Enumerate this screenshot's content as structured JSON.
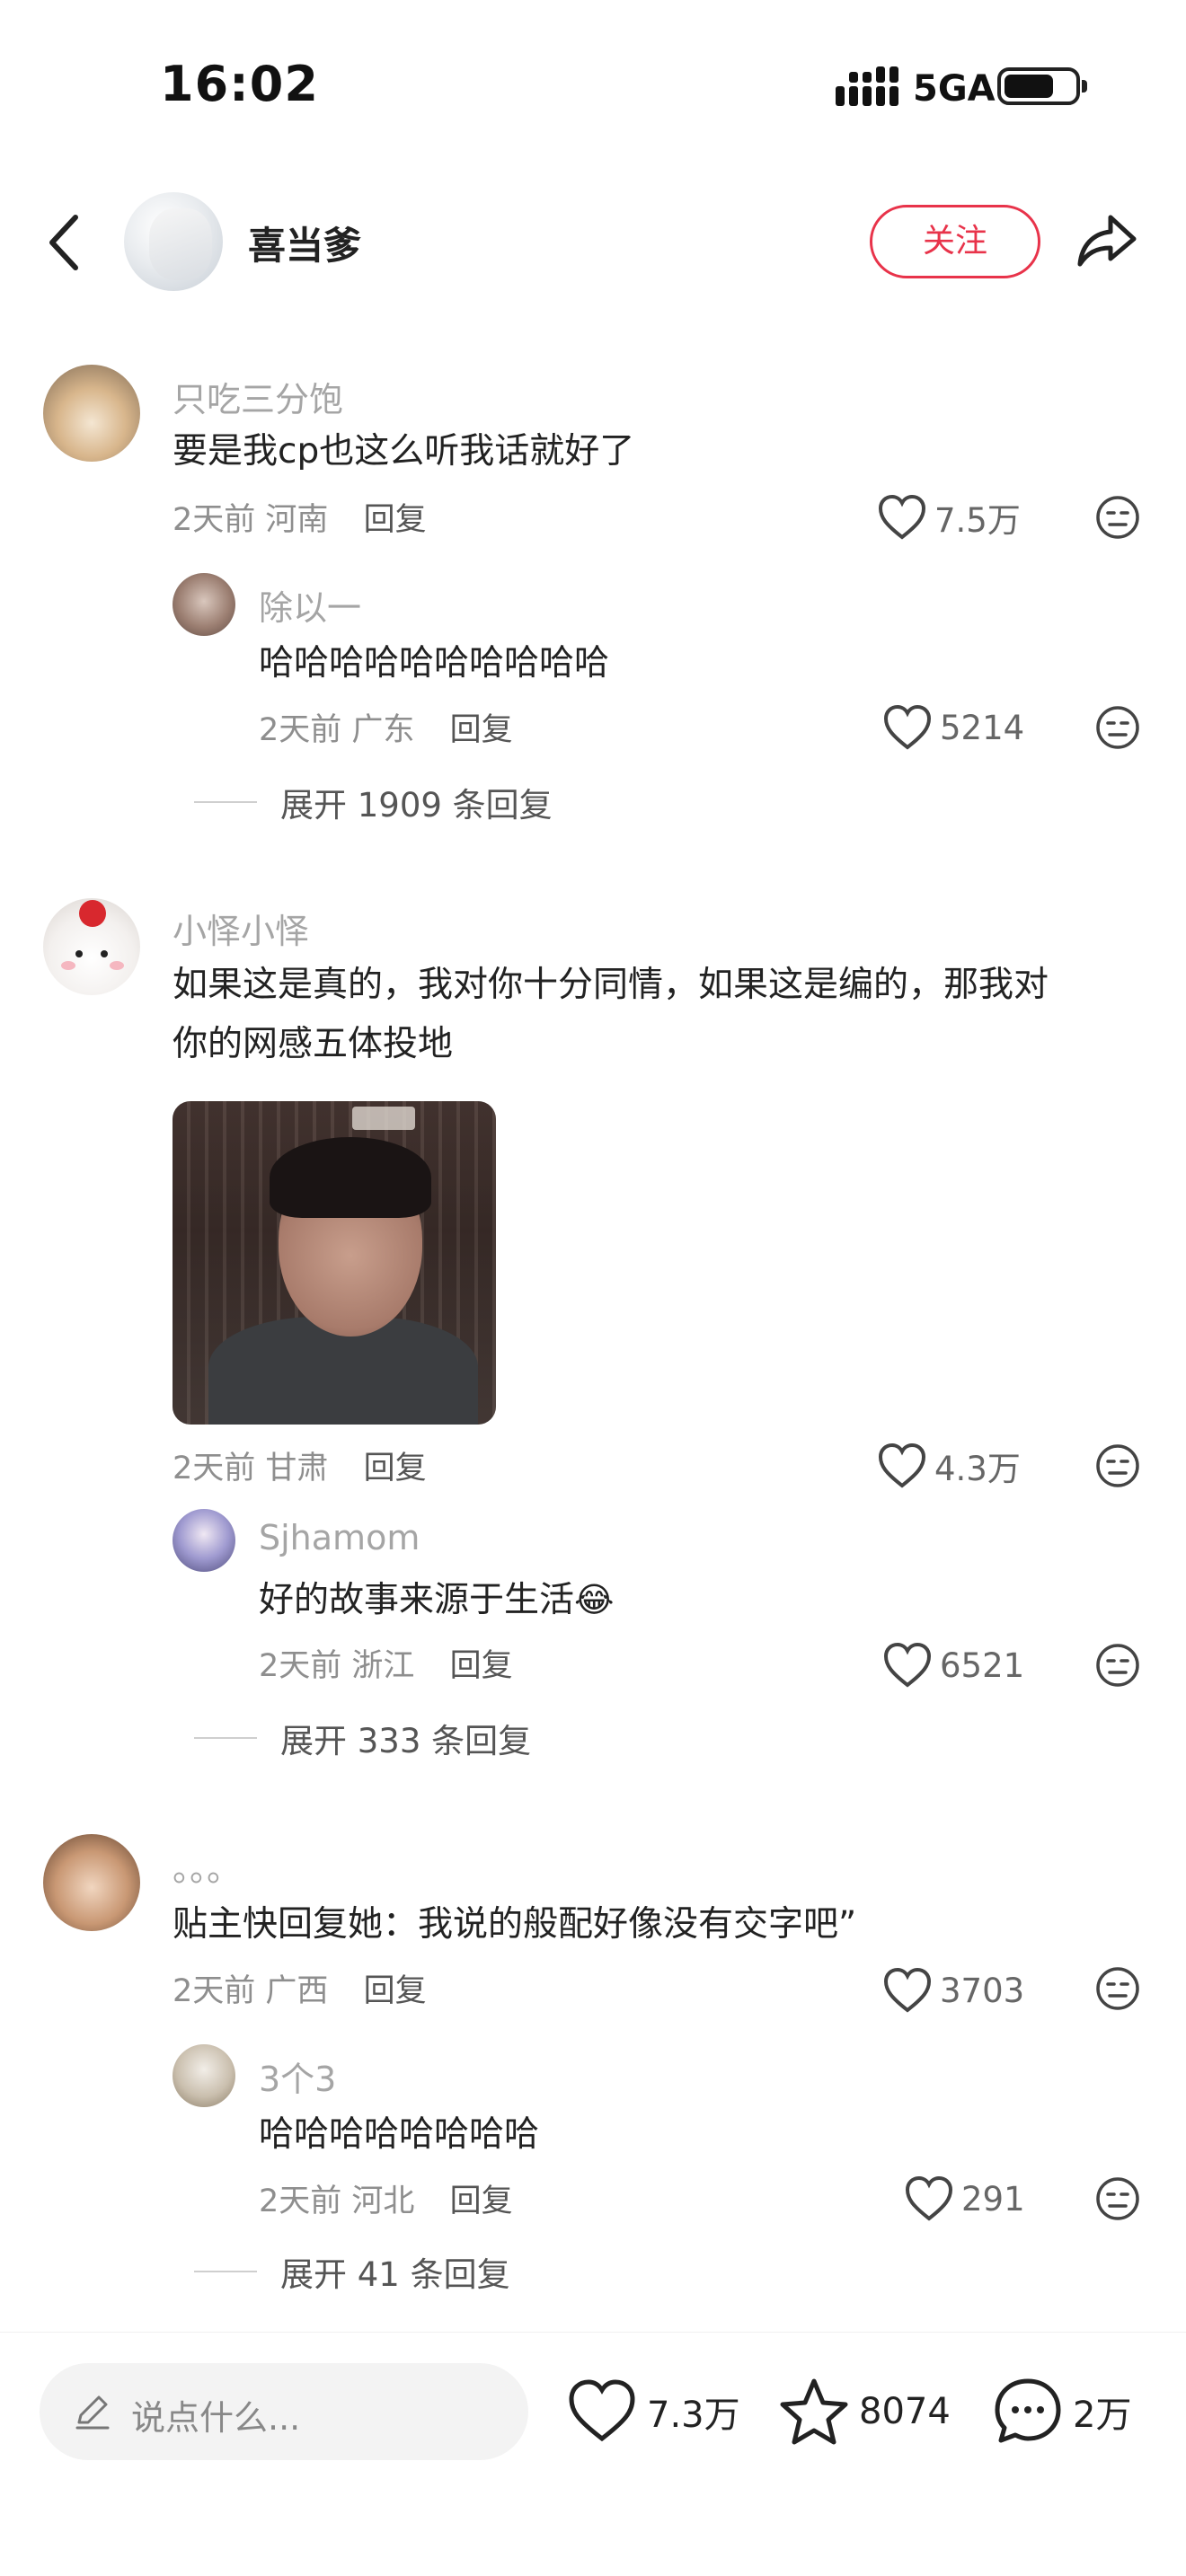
{
  "status_bar": {
    "time": "16:02",
    "network": "5GA"
  },
  "header": {
    "username": "喜当爹",
    "follow_label": "关注"
  },
  "comments": [
    {
      "username": "只吃三分饱",
      "text": "要是我cp也这么听我话就好了",
      "time": "2天前",
      "location": "河南",
      "reply_label": "回复",
      "likes": "7.5万",
      "replies": [
        {
          "username": "除以一",
          "text": "哈哈哈哈哈哈哈哈哈哈",
          "time": "2天前",
          "location": "广东",
          "reply_label": "回复",
          "likes": "5214"
        }
      ],
      "expand_label": "展开 1909 条回复"
    },
    {
      "username": "小怿小怿",
      "text_lines": [
        "如果这是真的，我对你十分同情，如果这是编的，那我对",
        "你的网感五体投地"
      ],
      "time": "2天前",
      "location": "甘肃",
      "reply_label": "回复",
      "likes": "4.3万",
      "replies": [
        {
          "username": "Sjhamom",
          "text": "好的故事来源于生活",
          "emoji": "😂",
          "time": "2天前",
          "location": "浙江",
          "reply_label": "回复",
          "likes": "6521"
        }
      ],
      "expand_label": "展开 333 条回复"
    },
    {
      "username": "。。。",
      "text": "贴主快回复她：我说的般配好像没有交字吧”",
      "time": "2天前",
      "location": "广西",
      "reply_label": "回复",
      "likes": "3703",
      "replies": [
        {
          "username": "3个3",
          "text": "哈哈哈哈哈哈哈哈",
          "time": "2天前",
          "location": "河北",
          "reply_label": "回复",
          "likes": "291"
        }
      ],
      "expand_label": "展开 41 条回复"
    }
  ],
  "bottom_bar": {
    "input_placeholder": "说点什么...",
    "likes": "7.3万",
    "favorites": "8074",
    "comments": "2万"
  },
  "colors": {
    "accent": "#e8334a",
    "text": "#222222",
    "muted": "#a5a5a5"
  }
}
